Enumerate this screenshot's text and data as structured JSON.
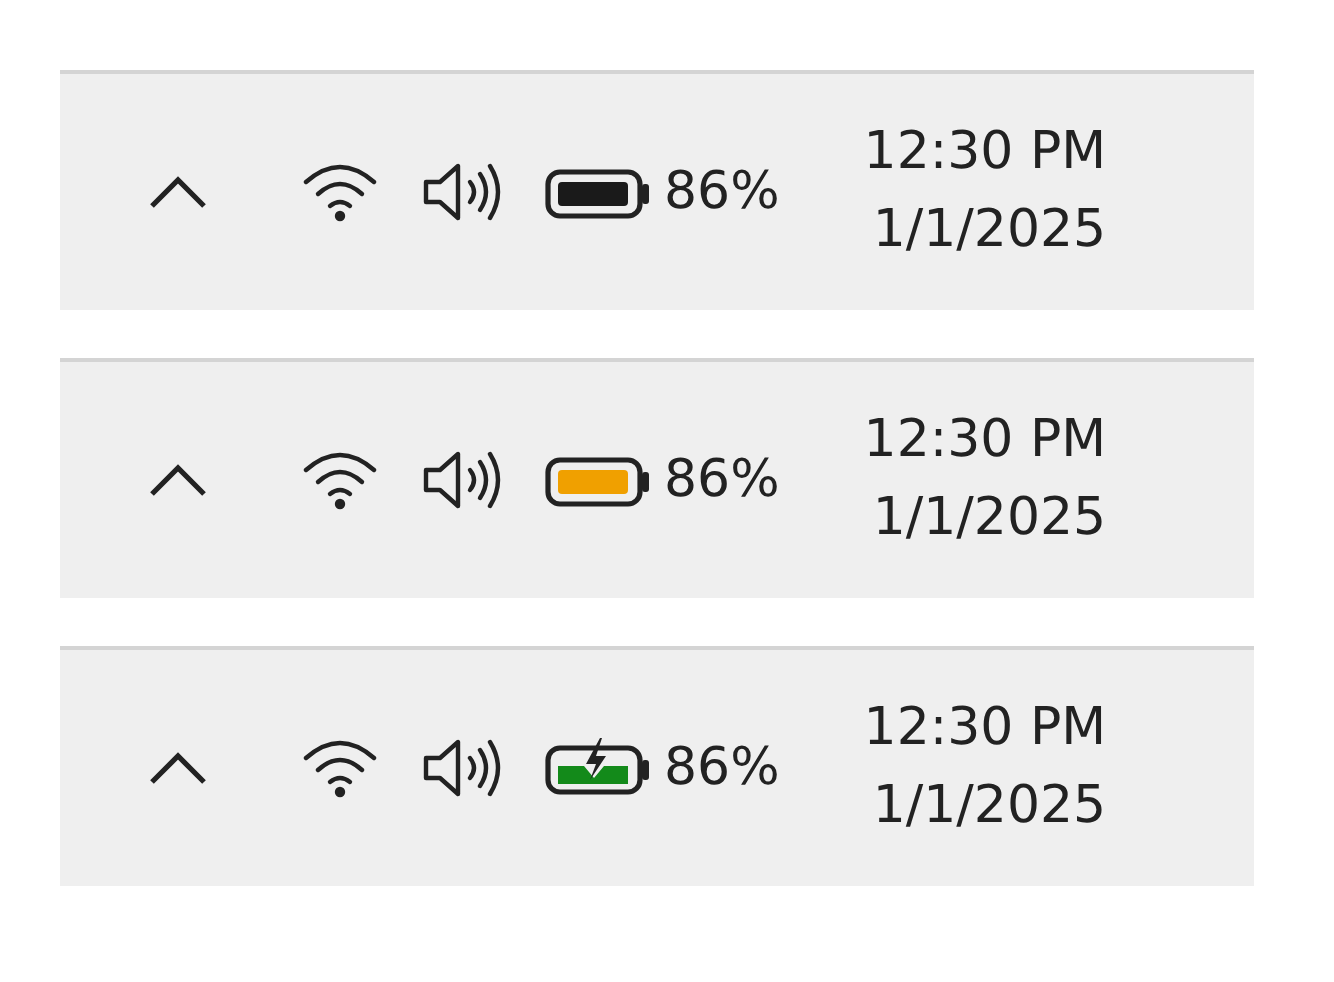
{
  "trays": [
    {
      "battery": {
        "kind": "normal",
        "color": "#1a1a1a"
      },
      "percent": "86%",
      "time": "12:30 PM",
      "date": "1/1/2025"
    },
    {
      "battery": {
        "kind": "saver",
        "color": "#f0a000"
      },
      "percent": "86%",
      "time": "12:30 PM",
      "date": "1/1/2025"
    },
    {
      "battery": {
        "kind": "charging",
        "color": "#138a1a"
      },
      "percent": "86%",
      "time": "12:30 PM",
      "date": "1/1/2025"
    }
  ]
}
